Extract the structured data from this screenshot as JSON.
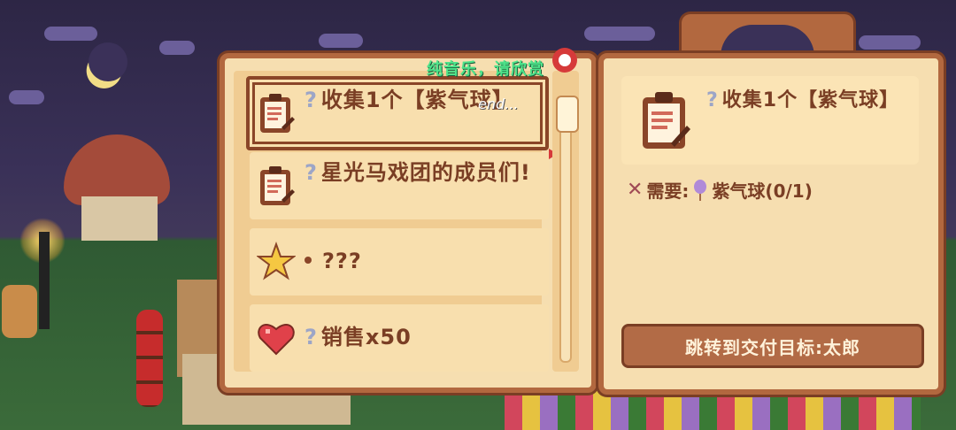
{
  "overlay": {
    "music_notice": "纯音乐，请欣赏",
    "end_label": "end..."
  },
  "quest_list": {
    "items": [
      {
        "icon": "clipboard-icon",
        "prefix": "?",
        "title": "收集1个【紫气球】",
        "selected": true
      },
      {
        "icon": "clipboard-icon",
        "prefix": "?",
        "title": "星光马戏团的成员们!",
        "selected": false
      },
      {
        "icon": "star-icon",
        "prefix": "•",
        "title": "???",
        "selected": false
      },
      {
        "icon": "heart-icon",
        "prefix": "?",
        "title": "销售x50",
        "selected": false
      }
    ]
  },
  "detail": {
    "icon": "clipboard-icon",
    "prefix": "?",
    "title": "收集1个【紫气球】",
    "requirement_mark": "✕",
    "requirement_label": "需要:",
    "requirement_item_icon": "balloon-icon",
    "requirement_text": "紫气球(0/1)",
    "jump_button": "跳转到交付目标:太郎"
  },
  "colors": {
    "panel_fill": "#f6deb0",
    "panel_border": "#b2683f",
    "text_brown": "#7a3e24",
    "question_mark": "#9ca5c7",
    "music_text": "#4de38a",
    "button_fill": "#b26b46"
  }
}
